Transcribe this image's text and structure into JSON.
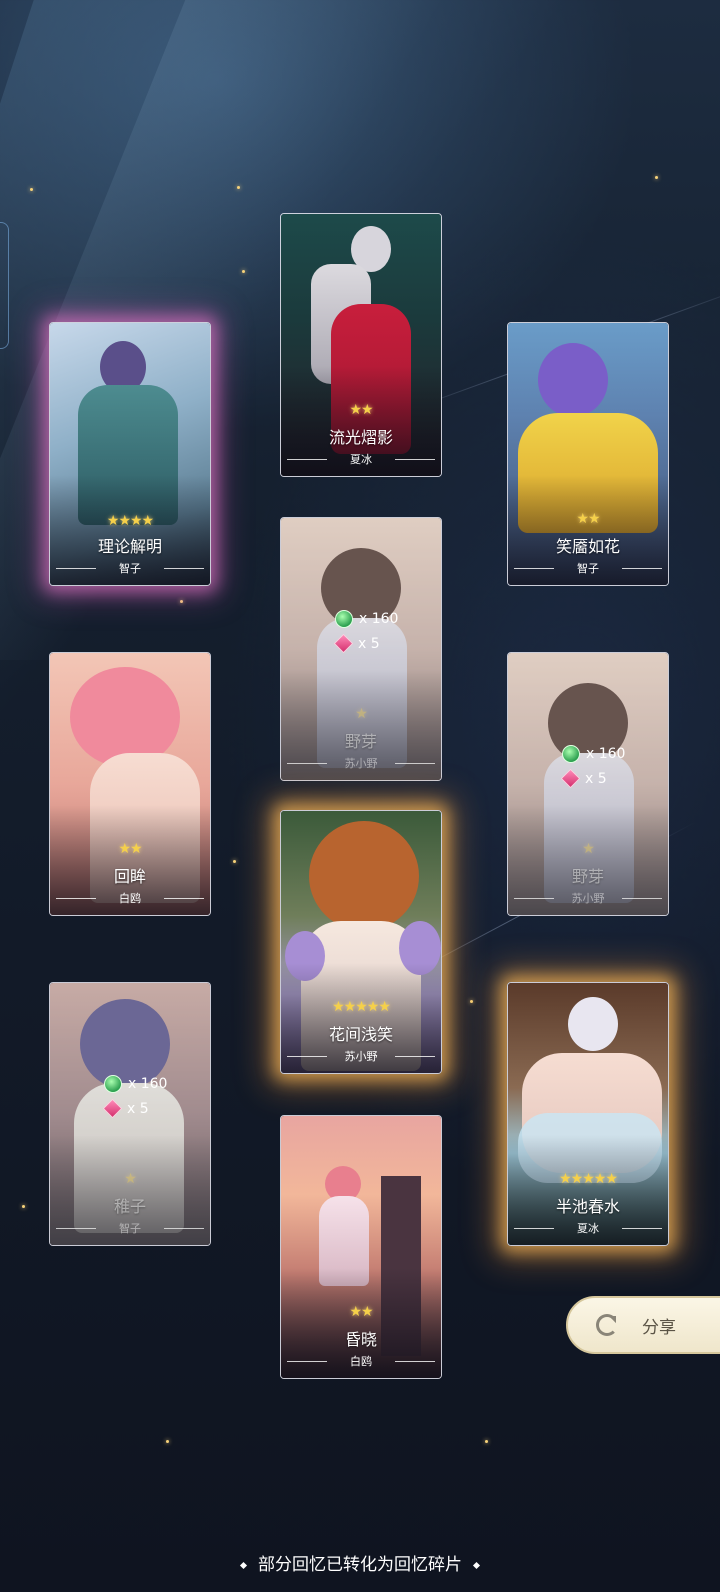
{
  "cards": [
    {
      "id": "c1",
      "title": "理论解明",
      "character": "智子",
      "stars": "★★★★",
      "dimmed": false
    },
    {
      "id": "c2",
      "title": "流光熠影",
      "character": "夏冰",
      "stars": "★★",
      "dimmed": false
    },
    {
      "id": "c3",
      "title": "笑靥如花",
      "character": "智子",
      "stars": "★★",
      "dimmed": false
    },
    {
      "id": "c4",
      "title": "野芽",
      "character": "苏小野",
      "stars": "★",
      "dimmed": true,
      "reward_gem": "x 160",
      "reward_fragment": "x 5"
    },
    {
      "id": "c5",
      "title": "回眸",
      "character": "白鸥",
      "stars": "★★",
      "dimmed": false
    },
    {
      "id": "c6",
      "title": "野芽",
      "character": "苏小野",
      "stars": "★",
      "dimmed": true,
      "reward_gem": "x 160",
      "reward_fragment": "x 5"
    },
    {
      "id": "c7",
      "title": "花间浅笑",
      "character": "苏小野",
      "stars": "★★★★★",
      "dimmed": false
    },
    {
      "id": "c8",
      "title": "稚子",
      "character": "智子",
      "stars": "★",
      "dimmed": true,
      "reward_gem": "x 160",
      "reward_fragment": "x 5"
    },
    {
      "id": "c9",
      "title": "半池春水",
      "character": "夏冰",
      "stars": "★★★★★",
      "dimmed": false
    },
    {
      "id": "c10",
      "title": "昏晓",
      "character": "白鸥",
      "stars": "★★",
      "dimmed": false
    }
  ],
  "share": {
    "label": "分享",
    "icon": "share-refresh-icon"
  },
  "footer": {
    "note": "部分回忆已转化为回忆碎片"
  },
  "colors": {
    "gold_glow": "#ffbe5a",
    "pink_glow": "#e678c8",
    "star": "#f5d04a"
  }
}
